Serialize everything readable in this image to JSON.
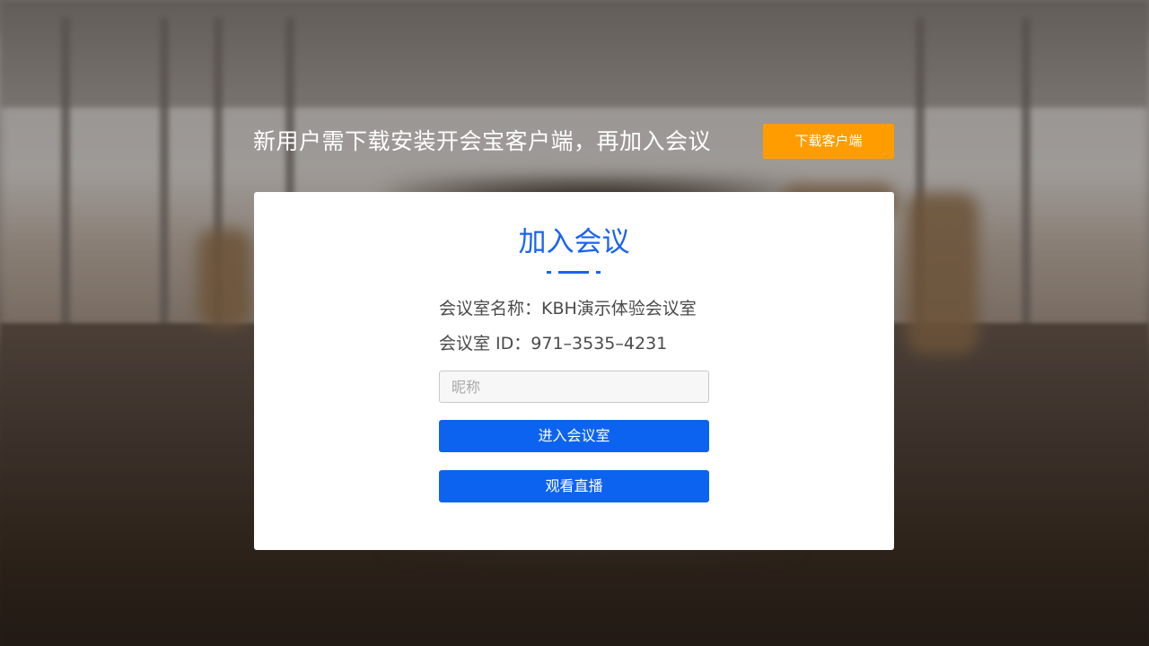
{
  "header": {
    "notice": "新用户需下载安装开会宝客户端，再加入会议",
    "download_button": "下载客户端"
  },
  "card": {
    "title": "加入会议",
    "room_name_line": "会议室名称：KBH演示体验会议室",
    "room_id_line": "会议室 ID：971–3535–4231",
    "nickname_placeholder": "昵称",
    "nickname_value": "",
    "enter_button": "进入会议室",
    "watch_live_button": "观看直播"
  },
  "colors": {
    "accent_blue": "#0c63ef",
    "title_blue": "#1a63f0",
    "download_orange": "#ff9d00"
  }
}
